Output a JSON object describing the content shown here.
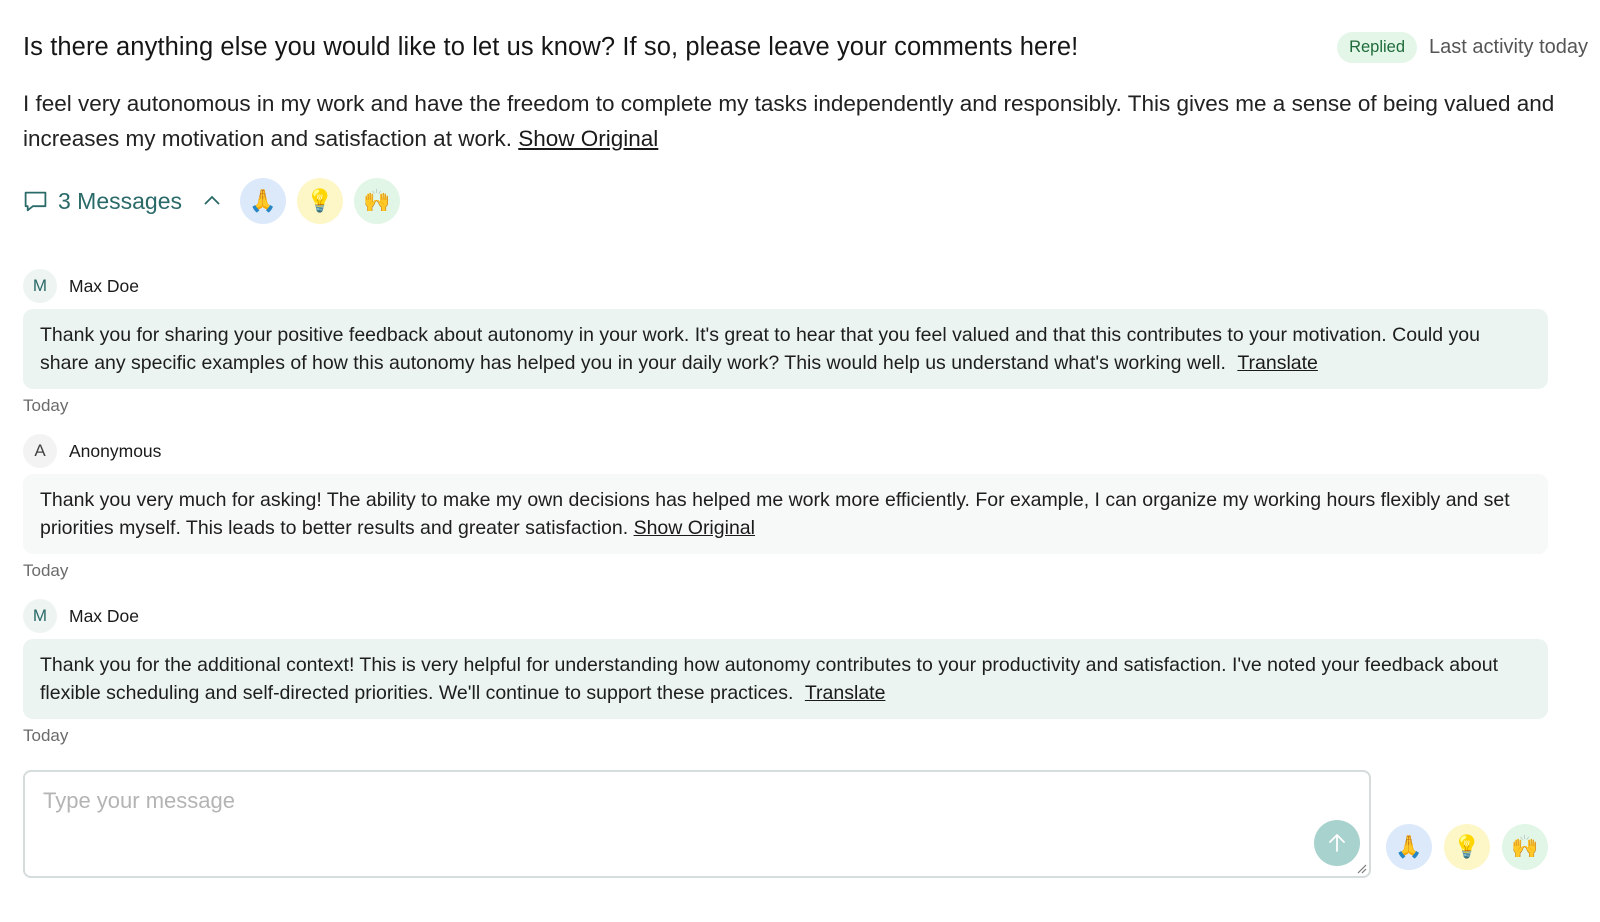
{
  "header": {
    "question": "Is there anything else you would like to let us know? If so, please leave your comments here!",
    "status": "Replied",
    "last_activity": "Last activity today"
  },
  "answer": {
    "text": "I feel very autonomous in my work and have the freedom to complete my tasks independently and responsibly. This gives me a sense of being valued and increases my motivation and satisfaction at work.",
    "show_original": "Show Original"
  },
  "toolbar": {
    "messages_label": "3 Messages",
    "reactions": [
      "🙏",
      "💡",
      "🙌"
    ]
  },
  "messages": [
    {
      "avatar": "M",
      "author": "Max Doe",
      "text": "Thank you for sharing your positive feedback about autonomy in your work. It's great to hear that you feel valued and that this contributes to your motivation. Could you share any specific examples of how this autonomy has helped you in your daily work? This would help us understand what's working well.",
      "link": "Translate",
      "time": "Today"
    },
    {
      "avatar": "A",
      "author": "Anonymous",
      "text": "Thank you very much for asking! The ability to make my own decisions has helped me work more efficiently. For example, I can organize my working hours flexibly and set priorities myself. This leads to better results and greater satisfaction.",
      "link": "Show Original",
      "time": "Today"
    },
    {
      "avatar": "M",
      "author": "Max Doe",
      "text": "Thank you for the additional context! This is very helpful for understanding how autonomy contributes to your productivity and satisfaction. I've noted your feedback about flexible scheduling and self-directed priorities. We'll continue to support these practices.",
      "link": "Translate",
      "time": "Today"
    }
  ],
  "composer": {
    "placeholder": "Type your message",
    "reactions": [
      "🙏",
      "💡",
      "🙌"
    ]
  },
  "colors": {
    "accent": "#2a6a68",
    "staff_bubble": "#ebf4f1",
    "anon_bubble": "#f7f8f8",
    "badge_bg": "#e3f6e8",
    "send_button": "#a7d2cd"
  },
  "icons": {
    "messages": "speech-bubble-icon",
    "collapse": "chevron-up-icon",
    "send": "arrow-up-icon",
    "resize": "resize-grip-icon"
  }
}
